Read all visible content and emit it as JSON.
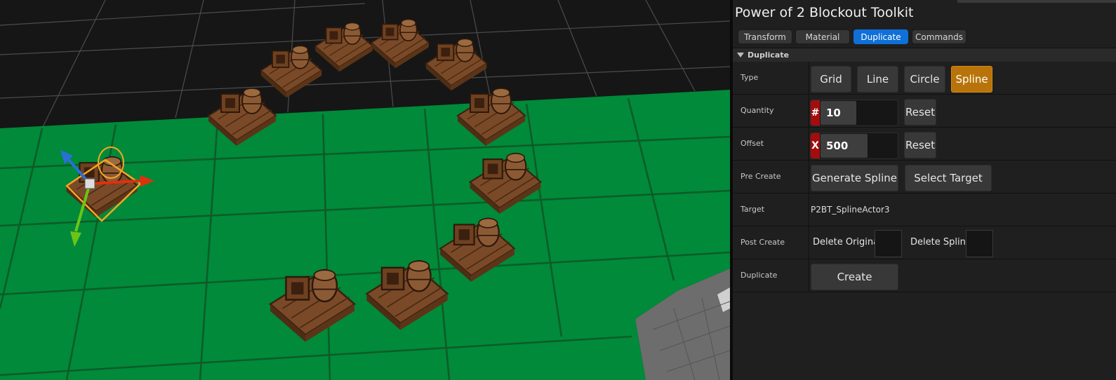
{
  "panel": {
    "title": "Power of 2 Blockout Toolkit",
    "tabs": [
      {
        "label": "Transform",
        "active": false
      },
      {
        "label": "Material",
        "active": false
      },
      {
        "label": "Duplicate",
        "active": true
      },
      {
        "label": "Commands",
        "active": false
      }
    ],
    "section": "Duplicate",
    "rows": {
      "type": {
        "label": "Type",
        "options": [
          "Grid",
          "Line",
          "Circle",
          "Spline"
        ],
        "selected": "Spline"
      },
      "quantity": {
        "label": "Quantity",
        "prefix": "#",
        "value": "10",
        "reset": "Reset"
      },
      "offset": {
        "label": "Offset",
        "prefix": "X",
        "value": "500",
        "reset": "Reset"
      },
      "pre_create": {
        "label": "Pre Create",
        "generate": "Generate Spline",
        "select": "Select Target"
      },
      "target": {
        "label": "Target",
        "value": "P2BT_SplineActor3"
      },
      "post_create": {
        "label": "Post Create",
        "delete_original": "Delete Original",
        "delete_spline": "Delete Spline"
      },
      "duplicate": {
        "label": "Duplicate",
        "create": "Create"
      }
    }
  },
  "colors": {
    "accent_blue": "#0e70d8",
    "selected_orange": "#b8740a",
    "prefix_red": "#a30d0d",
    "floor_green": "#008a3a",
    "wood": "#8b5a34"
  },
  "viewport": {
    "description_icons": [
      "transform-gizmo-icon",
      "crate-prop",
      "barrel-prop"
    ]
  }
}
